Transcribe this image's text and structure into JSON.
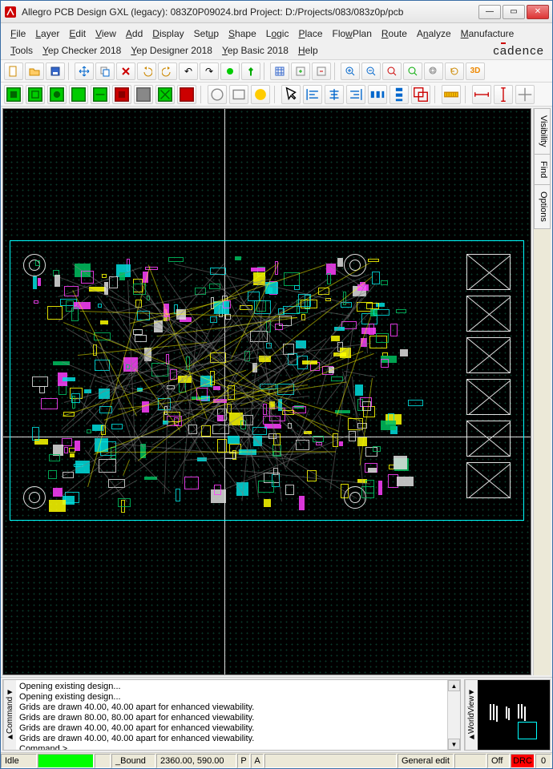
{
  "window": {
    "title": "Allegro PCB Design GXL (legacy): 083Z0P09024.brd   Project: D:/Projects/083/083z0p/pcb"
  },
  "menus": [
    "File",
    "Layer",
    "Edit",
    "View",
    "Add",
    "Display",
    "Setup",
    "Shape",
    "Logic",
    "Place",
    "FlowPlan",
    "Route",
    "Analyze",
    "Manufacture",
    "Tools",
    "Yep Checker 2018",
    "Yep Designer 2018",
    "Yep Basic 2018",
    "Help"
  ],
  "brand": "cādence",
  "sidetabs": [
    "Visibility",
    "Find",
    "Options"
  ],
  "command": {
    "label": "Command",
    "lines": [
      "Opening existing design...",
      "Opening existing design...",
      "  Grids are drawn 40.00, 40.00 apart for enhanced viewability.",
      "  Grids are drawn 80.00, 80.00 apart for enhanced viewability.",
      "  Grids are drawn 40.00, 40.00 apart for enhanced viewability.",
      "  Grids are drawn 40.00, 40.00 apart for enhanced viewability.",
      "Command >"
    ]
  },
  "worldview_label": "WorldView",
  "status": {
    "idle": "Idle",
    "bound": "_Bound",
    "coords": "2360.00, 590.00",
    "p": "P",
    "a": "A",
    "mode": "General edit",
    "off": "Off",
    "drc": "DRC",
    "count": "0"
  },
  "toolbar1": [
    "new",
    "open",
    "save",
    "sep",
    "move",
    "copy",
    "delete",
    "undo",
    "redo",
    "undo2",
    "redo2",
    "marker",
    "pin",
    "sep",
    "grid",
    "assign",
    "unassign",
    "sep",
    "zoom-in",
    "zoom-out",
    "zoom-fit",
    "zoom-sel",
    "zoom-win",
    "refresh",
    "3d"
  ],
  "toolbar2": [
    "l1",
    "l2",
    "l3",
    "l4",
    "l5",
    "l6",
    "l7",
    "l8",
    "l9",
    "l10",
    "sep",
    "c1",
    "c2",
    "c3",
    "sep",
    "sel",
    "a1",
    "a2",
    "a3",
    "a4",
    "a5",
    "a6",
    "sep",
    "g1",
    "sep",
    "r1",
    "r2",
    "r3"
  ],
  "colors": {
    "outline": "#00ffff",
    "comp_green": "#00c060",
    "comp_cyan": "#00e0e0",
    "comp_yellow": "#ffff00",
    "comp_magenta": "#ff40ff",
    "comp_white": "#e0e0e0",
    "rat_gray": "#808080",
    "rat_yellow": "#ffff00"
  }
}
